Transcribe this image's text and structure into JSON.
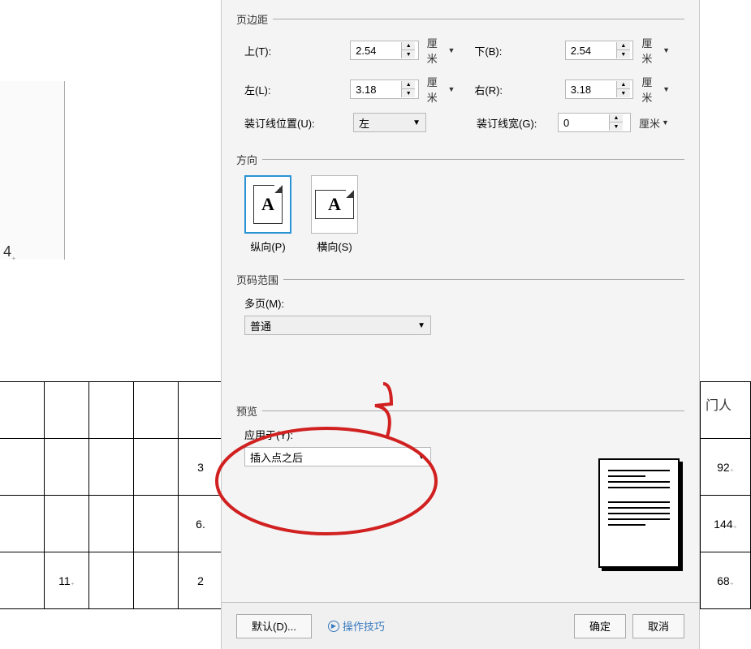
{
  "background": {
    "marker": "4",
    "rightHeader": "门人",
    "rows": [
      {
        "c0": "",
        "c1": "",
        "c2": "",
        "c3": "",
        "c4": "",
        "right": ""
      },
      {
        "c0": "",
        "c1": "",
        "c2": "",
        "c3": "",
        "c4": "3",
        "right": "92"
      },
      {
        "c0": "",
        "c1": "",
        "c2": "",
        "c3": "",
        "c4": "6.",
        "right": "144"
      },
      {
        "c0": "",
        "c1": "11",
        "c2": "",
        "c3": "",
        "c4": "2",
        "right": "68"
      }
    ]
  },
  "dialog": {
    "margins": {
      "legend": "页边距",
      "top": {
        "label": "上(T):",
        "value": "2.54",
        "unit": "厘米"
      },
      "bottom": {
        "label": "下(B):",
        "value": "2.54",
        "unit": "厘米"
      },
      "left": {
        "label": "左(L):",
        "value": "3.18",
        "unit": "厘米"
      },
      "right": {
        "label": "右(R):",
        "value": "3.18",
        "unit": "厘米"
      },
      "gutterPos": {
        "label": "装订线位置(U):",
        "value": "左"
      },
      "gutterWidth": {
        "label": "装订线宽(G):",
        "value": "0",
        "unit": "厘米"
      }
    },
    "orientation": {
      "legend": "方向",
      "portrait": "纵向(P)",
      "landscape": "横向(S)"
    },
    "pageRange": {
      "legend": "页码范围",
      "multiLabel": "多页(M):",
      "multiValue": "普通"
    },
    "preview": {
      "legend": "预览",
      "applyToLabel": "应用于(Y):",
      "applyToValue": "插入点之后"
    },
    "buttons": {
      "default": "默认(D)...",
      "tips": "操作技巧",
      "ok": "确定",
      "cancel": "取消"
    }
  }
}
